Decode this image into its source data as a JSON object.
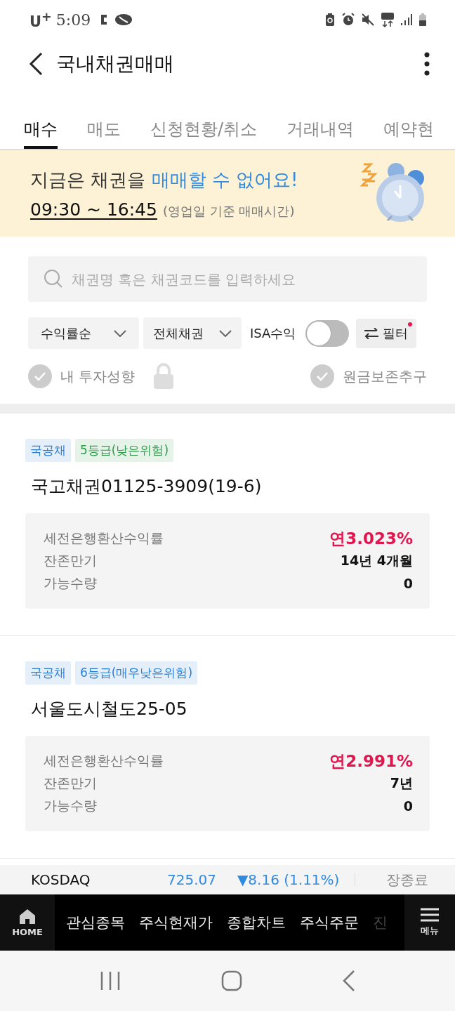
{
  "status_bar": {
    "carrier": "U$^{+}$",
    "time": "5:09"
  },
  "header": {
    "title": "국내채권매매"
  },
  "tabs": [
    {
      "label": "매수",
      "selected": true
    },
    {
      "label": "매도",
      "selected": false
    },
    {
      "label": "신청현황/취소",
      "selected": false
    },
    {
      "label": "거래내역",
      "selected": false
    },
    {
      "label": "예약현",
      "selected": false
    }
  ],
  "banner": {
    "title": "지금은 채권을 ",
    "title_highlight": "매매할 수 없어요!",
    "hours": "09:30 ~ 16:45",
    "note": "(영업일 기준 매매시간)"
  },
  "search": {
    "placeholder": "채권명 혹은 채권코드를 입력하세요"
  },
  "filters": {
    "sort": "수익률순",
    "category": "전체채권",
    "isa_label": "ISA수익",
    "isa_on": false,
    "filter_button": "필터",
    "filter_active": true
  },
  "options": [
    {
      "label": "내 투자성향",
      "checked": false,
      "locked": true
    },
    {
      "label": "원금보존추구",
      "checked": false,
      "locked": false
    }
  ],
  "bonds": [
    {
      "tags": [
        {
          "label": "국공채",
          "color": "#2a7fd4"
        },
        {
          "label": "5등급(낮은위험)",
          "color": "#2e9b4a"
        }
      ],
      "name": "국고채권01125-3909(19-6)",
      "rows": [
        {
          "label": "세전은행환산수익률",
          "value": "연3.023%",
          "kind": "yield"
        },
        {
          "label": "잔존만기",
          "value": "14년 4개월",
          "kind": "plain"
        },
        {
          "label": "가능수량",
          "value": "0",
          "kind": "plain"
        }
      ]
    },
    {
      "tags": [
        {
          "label": "국공채",
          "color": "#2a7fd4"
        },
        {
          "label": "6등급(매우낮은위험)",
          "color": "#2a7fd4"
        }
      ],
      "name": "서울도시철도25-05",
      "rows": [
        {
          "label": "세전은행환산수익률",
          "value": "연2.991%",
          "kind": "yield"
        },
        {
          "label": "잔존만기",
          "value": "7년",
          "kind": "plain"
        },
        {
          "label": "가능수량",
          "value": "0",
          "kind": "plain"
        }
      ]
    }
  ],
  "ticker": {
    "index": "KOSDAQ",
    "value": "725.07",
    "change": "▼8.16 (1.11%)",
    "status": "장종료"
  },
  "bottom_nav": {
    "home": "HOME",
    "items": [
      "관심종목",
      "주식현재가",
      "종합차트",
      "주식주문",
      "진"
    ],
    "menu": "메뉴"
  }
}
